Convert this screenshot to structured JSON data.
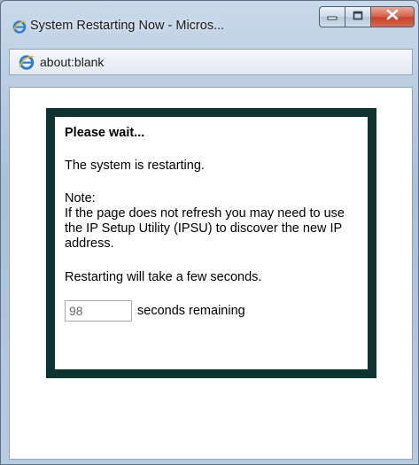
{
  "window": {
    "title": "System Restarting Now - Micros...",
    "address": "about:blank"
  },
  "dialog": {
    "heading": "Please wait...",
    "status": "The system is restarting.",
    "note_label": "Note:",
    "note_body": "If the page does not refresh you may need to use the IP Setup Utility (IPSU) to discover the new IP address.",
    "info": "Restarting will take a few seconds.",
    "countdown_value": "98",
    "countdown_label": "seconds remaining"
  },
  "colors": {
    "dialog_border": "#0e3432",
    "close_button": "#c7432b"
  }
}
